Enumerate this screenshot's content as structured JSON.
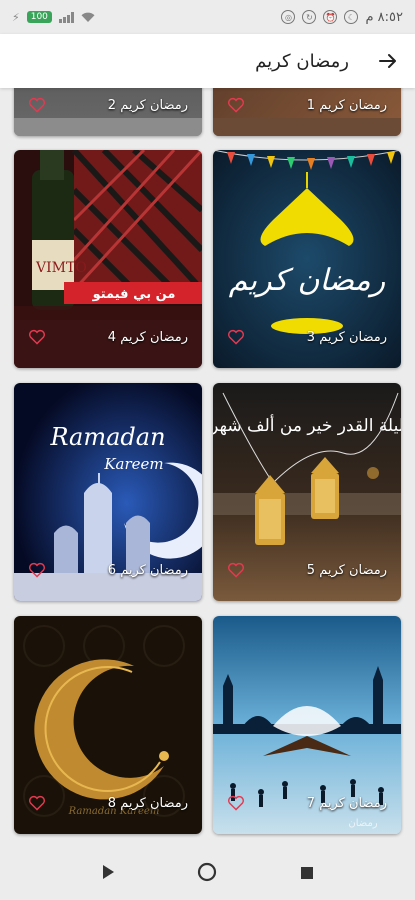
{
  "status_bar": {
    "time": "٨:٥٢ م",
    "battery": "100"
  },
  "app_bar": {
    "title": "رمضان كريم"
  },
  "cards": [
    {
      "label": "رمضان كريم 2"
    },
    {
      "label": "رمضان كريم 1"
    },
    {
      "label": "رمضان كريم 4"
    },
    {
      "label": "رمضان كريم 3"
    },
    {
      "label": "رمضان كريم 6"
    },
    {
      "label": "رمضان كريم 5"
    },
    {
      "label": "رمضان كريم 8"
    },
    {
      "label": "رمضان كريم 7"
    }
  ],
  "art_text": {
    "card3": "رمضان كريم",
    "card4_line1": "من بي فيمتو",
    "card6_title": "Ramadan",
    "card6_sub": "Kareem",
    "card5": "ليلة القدر خير من ألف شهر",
    "card8_sub": "Ramadan Kareem",
    "card7_sub": "رمضان"
  },
  "colors": {
    "heart": "#e53950",
    "app_bar_bg": "#ffffff",
    "page_bg": "#ececec"
  }
}
